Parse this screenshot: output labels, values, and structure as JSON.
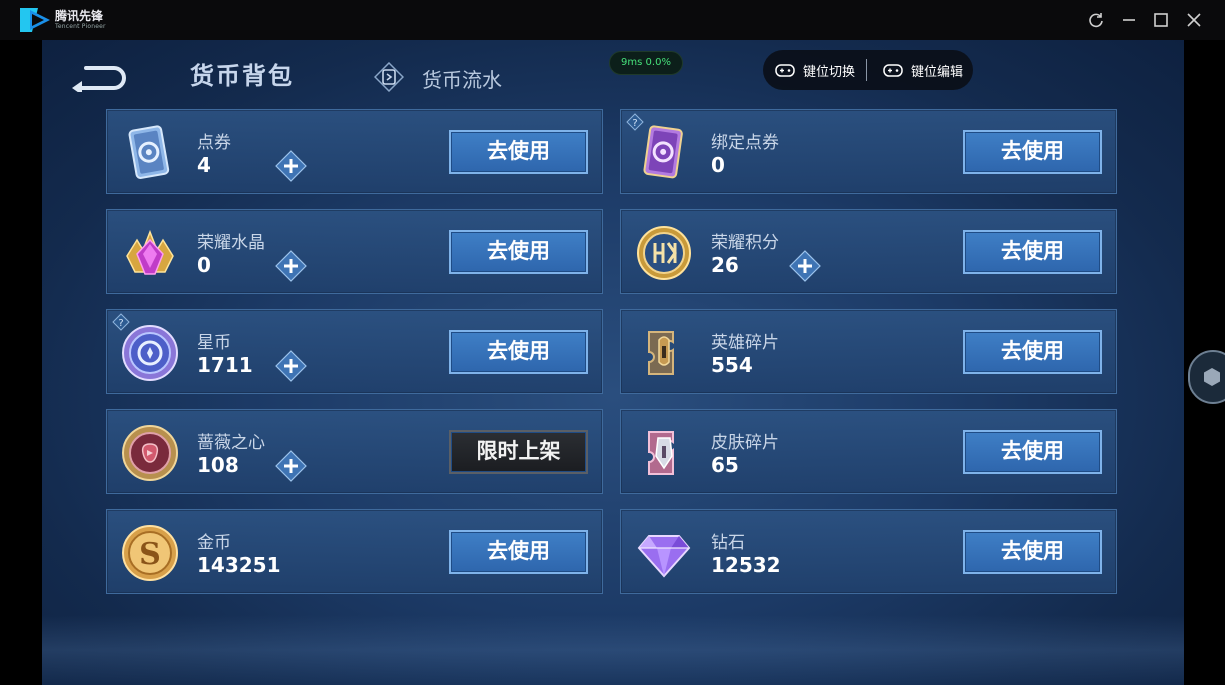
{
  "window": {
    "app_name": "腾讯先锋",
    "app_subtitle": "Tencent Pioneer",
    "controls": [
      "refresh-icon",
      "minimize-icon",
      "maximize-icon",
      "close-icon"
    ]
  },
  "header": {
    "title": "货币背包",
    "flow_tab_label": "货币流水",
    "ping": "9ms  0.0%",
    "key_switch_label": "键位切换",
    "key_edit_label": "键位编辑"
  },
  "currencies": [
    {
      "name": "点券",
      "value": "4",
      "action": "去使用",
      "plus": true,
      "help": false,
      "icon": "voucher-card-icon"
    },
    {
      "name": "绑定点券",
      "value": "0",
      "action": "去使用",
      "plus": false,
      "help": true,
      "icon": "bound-voucher-card-icon"
    },
    {
      "name": "荣耀水晶",
      "value": "0",
      "action": "去使用",
      "plus": true,
      "help": false,
      "icon": "glory-crystal-icon"
    },
    {
      "name": "荣耀积分",
      "value": "26",
      "action": "去使用",
      "plus": true,
      "help": false,
      "icon": "glory-points-icon"
    },
    {
      "name": "星币",
      "value": "1711",
      "action": "去使用",
      "plus": true,
      "help": true,
      "icon": "star-coin-icon"
    },
    {
      "name": "英雄碎片",
      "value": "554",
      "action": "去使用",
      "plus": false,
      "help": false,
      "icon": "hero-fragment-icon"
    },
    {
      "name": "蔷薇之心",
      "value": "108",
      "action": "限时上架",
      "plus": true,
      "help": false,
      "icon": "rose-heart-icon"
    },
    {
      "name": "皮肤碎片",
      "value": "65",
      "action": "去使用",
      "plus": false,
      "help": false,
      "icon": "skin-fragment-icon"
    },
    {
      "name": "金币",
      "value": "143251",
      "action": "去使用",
      "plus": false,
      "help": false,
      "icon": "gold-coin-icon"
    },
    {
      "name": "钻石",
      "value": "12532",
      "action": "去使用",
      "plus": false,
      "help": false,
      "icon": "diamond-icon"
    }
  ],
  "colors": {
    "accent": "#3f7fc6",
    "card_bg": "#2c5282",
    "ping_text": "#46e07a"
  }
}
